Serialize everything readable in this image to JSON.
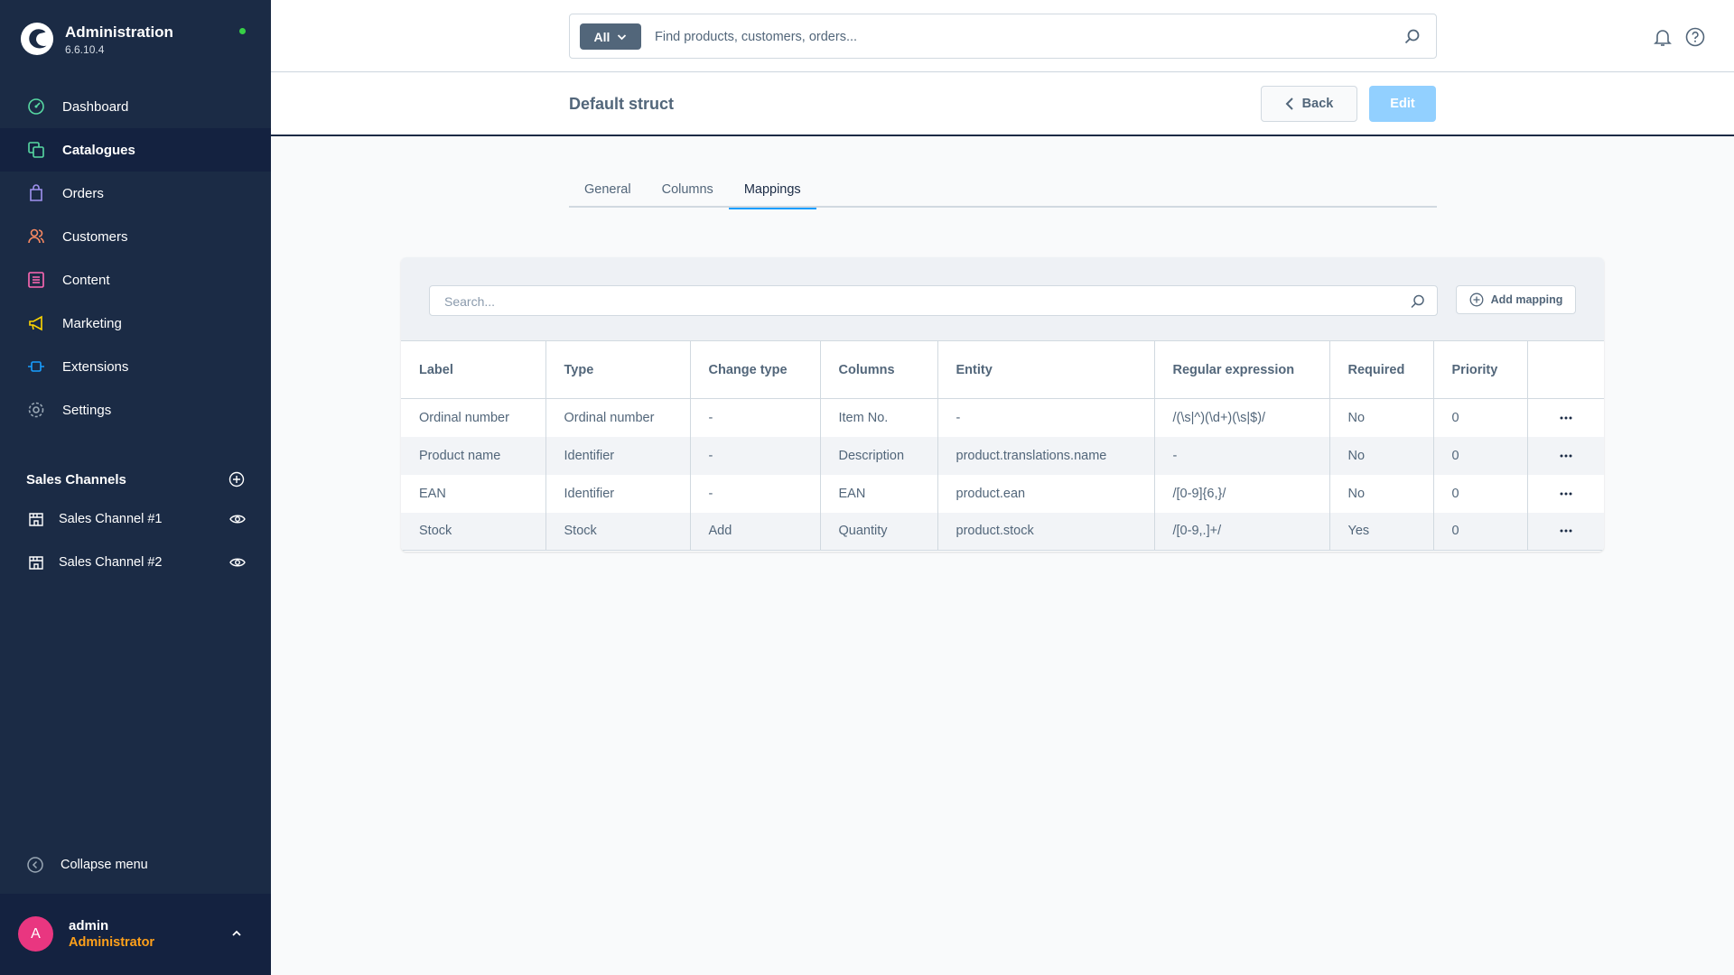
{
  "app": {
    "title": "Administration",
    "version": "6.6.10.4",
    "status_color": "#37d046"
  },
  "nav": {
    "items": [
      {
        "label": "Dashboard",
        "icon": "dashboard-icon",
        "color": "#57d9a3",
        "active": false
      },
      {
        "label": "Catalogues",
        "icon": "catalogue-icon",
        "color": "#57d9a3",
        "active": true
      },
      {
        "label": "Orders",
        "icon": "orders-icon",
        "color": "#a092f0",
        "active": false
      },
      {
        "label": "Customers",
        "icon": "customers-icon",
        "color": "#f88962",
        "active": false
      },
      {
        "label": "Content",
        "icon": "content-icon",
        "color": "#ff68b4",
        "active": false
      },
      {
        "label": "Marketing",
        "icon": "marketing-icon",
        "color": "#ffd700",
        "active": false
      },
      {
        "label": "Extensions",
        "icon": "extensions-icon",
        "color": "#189eff",
        "active": false
      },
      {
        "label": "Settings",
        "icon": "settings-icon",
        "color": "#9aa8b5",
        "active": false
      }
    ]
  },
  "sales_channels": {
    "title": "Sales Channels",
    "items": [
      {
        "label": "Sales Channel #1"
      },
      {
        "label": "Sales Channel #2"
      }
    ]
  },
  "collapse_label": "Collapse menu",
  "user": {
    "initial": "A",
    "name": "admin",
    "role": "Administrator"
  },
  "search": {
    "type": "All",
    "placeholder": "Find products, customers, orders..."
  },
  "page": {
    "title": "Default struct",
    "back_label": "Back",
    "edit_label": "Edit"
  },
  "tabs": [
    {
      "label": "General",
      "active": false
    },
    {
      "label": "Columns",
      "active": false
    },
    {
      "label": "Mappings",
      "active": true
    }
  ],
  "mappings": {
    "search_placeholder": "Search...",
    "add_label": "Add mapping",
    "columns": [
      "Label",
      "Type",
      "Change type",
      "Columns",
      "Entity",
      "Regular expression",
      "Required",
      "Priority"
    ],
    "rows": [
      [
        "Ordinal number",
        "Ordinal number",
        "-",
        "Item No.",
        "-",
        "/(\\s|^)(\\d+)(\\s|$)/",
        "No",
        "0"
      ],
      [
        "Product name",
        "Identifier",
        "-",
        "Description",
        "product.translations.name",
        "-",
        "No",
        "0"
      ],
      [
        "EAN",
        "Identifier",
        "-",
        "EAN",
        "product.ean",
        "/[0-9]{6,}/",
        "No",
        "0"
      ],
      [
        "Stock",
        "Stock",
        "Add",
        "Quantity",
        "product.stock",
        "/[0-9,.]+/",
        "Yes",
        "0"
      ]
    ]
  }
}
